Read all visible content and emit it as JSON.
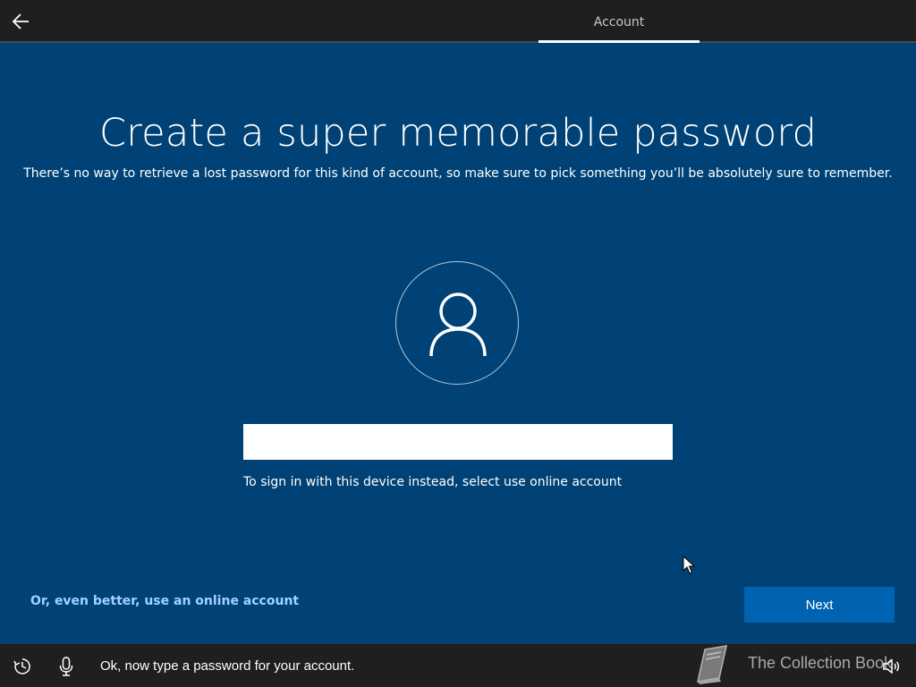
{
  "header": {
    "tab_label": "Account"
  },
  "main": {
    "title": "Create a super memorable password",
    "subtitle": "There’s no way to retrieve a lost password for this kind of account, so make sure to pick something you’ll be absolutely sure to remember.",
    "password_value": "",
    "hint": "To sign in with this device instead, select use online account"
  },
  "footer_actions": {
    "online_account_link": "Or, even better, use an online account",
    "next_label": "Next"
  },
  "bottombar": {
    "cortana_text": "Ok, now type a password for your account.",
    "watermark_text": "The Collection Book"
  },
  "icons": {
    "back": "back-arrow-icon",
    "avatar": "user-icon",
    "ease": "ease-of-access-icon",
    "mic": "microphone-icon",
    "volume": "volume-icon",
    "watermark": "book-logo"
  },
  "colors": {
    "background": "#004275",
    "bars": "#1f1f1f",
    "accent_button": "#0063b1",
    "link": "#9fd3ff"
  }
}
